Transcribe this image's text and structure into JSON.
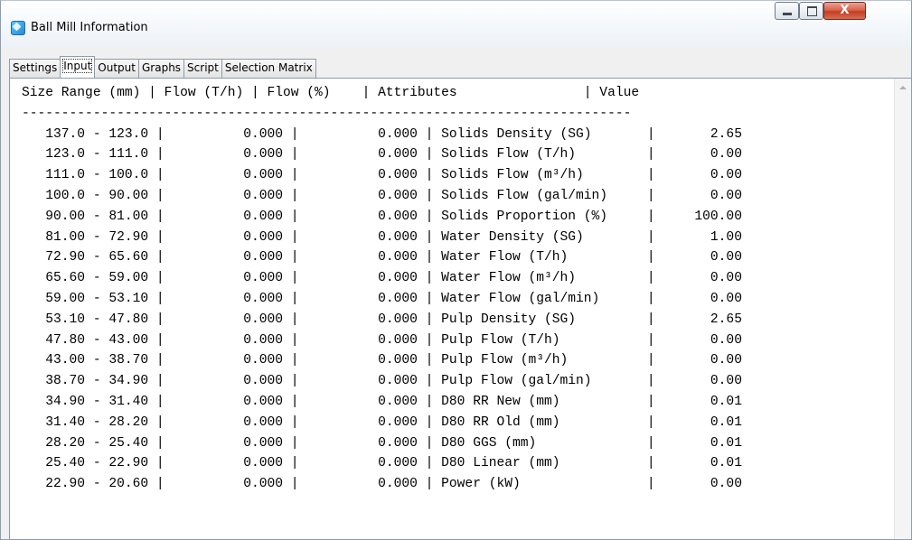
{
  "window": {
    "title": "Ball Mill Information",
    "close_glyph": "X",
    "icon": "app-window-icon"
  },
  "tabs": [
    {
      "label": "Settings"
    },
    {
      "label": "Input"
    },
    {
      "label": "Output"
    },
    {
      "label": "Graphs"
    },
    {
      "label": "Script"
    },
    {
      "label": "Selection Matrix"
    }
  ],
  "active_tab": "Input",
  "table": {
    "headers": [
      "Size Range (mm)",
      "Flow (T/h)",
      "Flow (%)",
      "Attributes",
      "Value"
    ],
    "rows": [
      {
        "size": "137.0 - 123.0",
        "flow_th": "0.000",
        "flow_pct": "0.000",
        "attribute": "Solids Density (SG)",
        "value": "2.65"
      },
      {
        "size": "123.0 - 111.0",
        "flow_th": "0.000",
        "flow_pct": "0.000",
        "attribute": "Solids Flow (T/h)",
        "value": "0.00"
      },
      {
        "size": "111.0 - 100.0",
        "flow_th": "0.000",
        "flow_pct": "0.000",
        "attribute": "Solids Flow (m³/h)",
        "value": "0.00"
      },
      {
        "size": "100.0 - 90.00",
        "flow_th": "0.000",
        "flow_pct": "0.000",
        "attribute": "Solids Flow (gal/min)",
        "value": "0.00"
      },
      {
        "size": "90.00 - 81.00",
        "flow_th": "0.000",
        "flow_pct": "0.000",
        "attribute": "Solids Proportion (%)",
        "value": "100.00"
      },
      {
        "size": "81.00 - 72.90",
        "flow_th": "0.000",
        "flow_pct": "0.000",
        "attribute": "Water Density (SG)",
        "value": "1.00"
      },
      {
        "size": "72.90 - 65.60",
        "flow_th": "0.000",
        "flow_pct": "0.000",
        "attribute": "Water Flow (T/h)",
        "value": "0.00"
      },
      {
        "size": "65.60 - 59.00",
        "flow_th": "0.000",
        "flow_pct": "0.000",
        "attribute": "Water Flow (m³/h)",
        "value": "0.00"
      },
      {
        "size": "59.00 - 53.10",
        "flow_th": "0.000",
        "flow_pct": "0.000",
        "attribute": "Water Flow (gal/min)",
        "value": "0.00"
      },
      {
        "size": "53.10 - 47.80",
        "flow_th": "0.000",
        "flow_pct": "0.000",
        "attribute": "Pulp Density (SG)",
        "value": "2.65"
      },
      {
        "size": "47.80 - 43.00",
        "flow_th": "0.000",
        "flow_pct": "0.000",
        "attribute": "Pulp Flow (T/h)",
        "value": "0.00"
      },
      {
        "size": "43.00 - 38.70",
        "flow_th": "0.000",
        "flow_pct": "0.000",
        "attribute": "Pulp Flow (m³/h)",
        "value": "0.00"
      },
      {
        "size": "38.70 - 34.90",
        "flow_th": "0.000",
        "flow_pct": "0.000",
        "attribute": "Pulp Flow (gal/min)",
        "value": "0.00"
      },
      {
        "size": "34.90 - 31.40",
        "flow_th": "0.000",
        "flow_pct": "0.000",
        "attribute": "D80 RR New (mm)",
        "value": "0.01"
      },
      {
        "size": "31.40 - 28.20",
        "flow_th": "0.000",
        "flow_pct": "0.000",
        "attribute": "D80 RR Old (mm)",
        "value": "0.01"
      },
      {
        "size": "28.20 - 25.40",
        "flow_th": "0.000",
        "flow_pct": "0.000",
        "attribute": "D80 GGS (mm)",
        "value": "0.01"
      },
      {
        "size": "25.40 - 22.90",
        "flow_th": "0.000",
        "flow_pct": "0.000",
        "attribute": "D80 Linear (mm)",
        "value": "0.01"
      },
      {
        "size": "22.90 - 20.60",
        "flow_th": "0.000",
        "flow_pct": "0.000",
        "attribute": "Power (kW)",
        "value": "0.00"
      }
    ]
  }
}
